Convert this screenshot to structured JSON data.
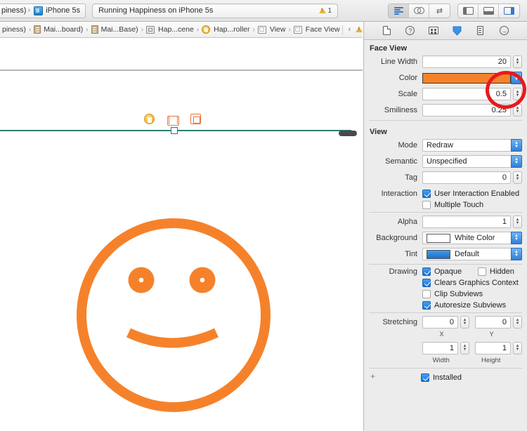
{
  "toolbar": {
    "scheme_project": "piness)",
    "scheme_device": "iPhone 5s",
    "device_icon": "iphone-device-icon",
    "status_text": "Running Happiness on iPhone 5s",
    "warning_count": "1",
    "warning_icon": "warning-triangle-icon",
    "editor_modes": [
      {
        "name": "standard-editor",
        "icon": "lines-icon",
        "active": true
      },
      {
        "name": "assistant-editor",
        "icon": "venn-circles-icon",
        "active": false
      },
      {
        "name": "version-editor",
        "icon": "two-way-arrow-icon",
        "active": false
      }
    ],
    "panel_toggles": [
      {
        "name": "navigator-toggle",
        "icon": "left-pane-icon",
        "active": false
      },
      {
        "name": "debug-area-toggle",
        "icon": "bottom-pane-icon",
        "active": false
      },
      {
        "name": "utilities-toggle",
        "icon": "right-pane-icon",
        "active": true
      }
    ]
  },
  "jumpbar": {
    "crumbs": [
      {
        "label": "piness)",
        "icon": "none"
      },
      {
        "label": "Mai...board)",
        "icon": "document-icon"
      },
      {
        "label": "Mai...Base)",
        "icon": "document-icon"
      },
      {
        "label": "Hap...cene",
        "icon": "storyboard-scene-icon"
      },
      {
        "label": "Hap...roller",
        "icon": "view-controller-icon"
      },
      {
        "label": "View",
        "icon": "view-icon"
      },
      {
        "label": "Face View",
        "icon": "view-icon"
      }
    ],
    "nav_prev": "‹",
    "nav_next": "›",
    "nav_warning_icon": "warning-triangle-icon"
  },
  "canvas": {
    "scene_dock": [
      {
        "name": "view-controller-dock-icon",
        "label": "View Controller"
      },
      {
        "name": "first-responder-dock-icon",
        "label": "First Responder"
      },
      {
        "name": "exit-dock-icon",
        "label": "Exit"
      }
    ],
    "face": {
      "name": "face-view-preview",
      "stroke_color": "#F5822B",
      "line_width": 20,
      "eye_count": 2,
      "expression": "slight-smile"
    }
  },
  "inspector": {
    "tabs": [
      {
        "name": "file-inspector-tab",
        "icon": "file-icon",
        "active": false
      },
      {
        "name": "quick-help-inspector-tab",
        "icon": "question-circle-icon",
        "active": false
      },
      {
        "name": "identity-inspector-tab",
        "icon": "identity-card-icon",
        "active": false
      },
      {
        "name": "attributes-inspector-tab",
        "icon": "attributes-diamond-icon",
        "active": true
      },
      {
        "name": "size-inspector-tab",
        "icon": "ruler-icon",
        "active": false
      },
      {
        "name": "connections-inspector-tab",
        "icon": "arrow-circle-icon",
        "active": false
      }
    ],
    "face_view": {
      "title": "Face View",
      "line_width_label": "Line Width",
      "line_width_value": "20",
      "color_label": "Color",
      "color_value": "#F5822B",
      "scale_label": "Scale",
      "scale_value": "0.5",
      "smiliness_label": "Smiliness",
      "smiliness_value": "0.25"
    },
    "view": {
      "title": "View",
      "mode_label": "Mode",
      "mode_value": "Redraw",
      "semantic_label": "Semantic",
      "semantic_value": "Unspecified",
      "tag_label": "Tag",
      "tag_value": "0",
      "interaction_label": "Interaction",
      "user_interaction_enabled_label": "User Interaction Enabled",
      "user_interaction_enabled_checked": true,
      "multiple_touch_label": "Multiple Touch",
      "multiple_touch_checked": false,
      "alpha_label": "Alpha",
      "alpha_value": "1",
      "background_label": "Background",
      "background_value": "White Color",
      "tint_label": "Tint",
      "tint_value": "Default",
      "drawing_label": "Drawing",
      "opaque_label": "Opaque",
      "opaque_checked": true,
      "hidden_label": "Hidden",
      "hidden_checked": false,
      "clears_graphics_label": "Clears Graphics Context",
      "clears_graphics_checked": true,
      "clip_subviews_label": "Clip Subviews",
      "clip_subviews_checked": false,
      "autoresize_subviews_label": "Autoresize Subviews",
      "autoresize_subviews_checked": true,
      "stretching_label": "Stretching",
      "stretch_x_value": "0",
      "stretch_y_value": "0",
      "stretch_x_label": "X",
      "stretch_y_label": "Y",
      "stretch_width_value": "1",
      "stretch_height_value": "1",
      "stretch_width_label": "Width",
      "stretch_height_label": "Height",
      "installed_label": "Installed",
      "installed_checked": true,
      "add_variation_label": "+"
    }
  },
  "annotation": {
    "name": "red-highlight-circle",
    "target": "scale-value",
    "color": "#E8191C"
  }
}
